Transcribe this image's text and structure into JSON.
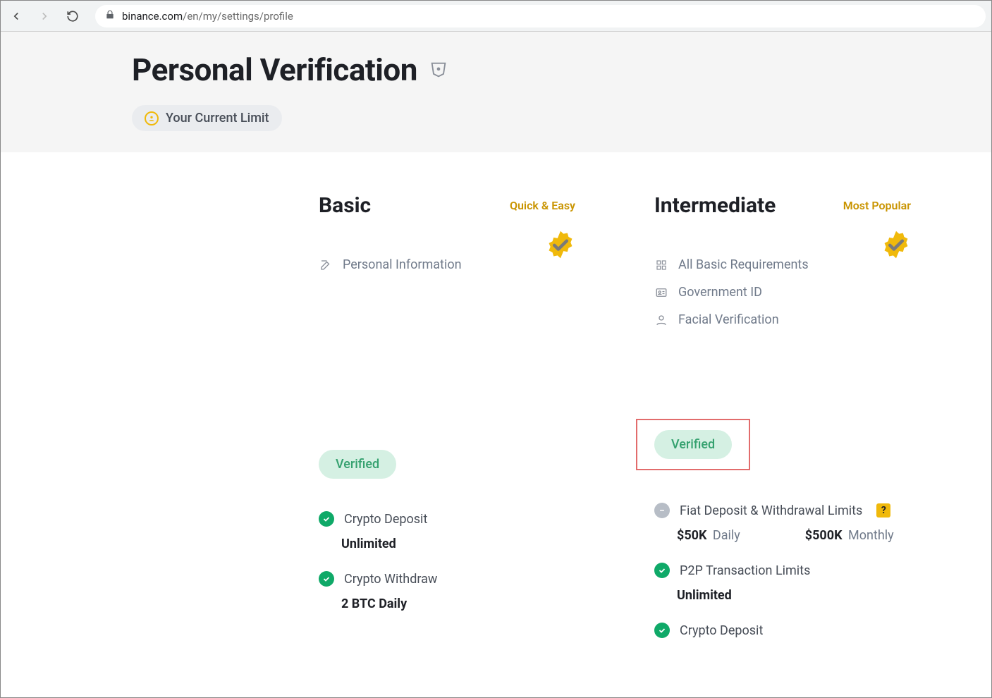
{
  "browser": {
    "url_domain": "binance.com",
    "url_path": "/en/my/settings/profile"
  },
  "header": {
    "title": "Personal Verification",
    "chip_label": "Your Current Limit"
  },
  "cards": {
    "basic": {
      "title": "Basic",
      "tag": "Quick & Easy",
      "req1": "Personal Information",
      "verified_label": "Verified",
      "limit1_label": "Crypto Deposit",
      "limit1_value": "Unlimited",
      "limit2_label": "Crypto Withdraw",
      "limit2_value": "2 BTC Daily"
    },
    "intermediate": {
      "title": "Intermediate",
      "tag": "Most Popular",
      "req1": "All Basic Requirements",
      "req2": "Government ID",
      "req3": "Facial Verification",
      "verified_label": "Verified",
      "fiat_label": "Fiat Deposit & Withdrawal Limits",
      "fiat_daily_amount": "$50K",
      "fiat_daily_period": "Daily",
      "fiat_monthly_amount": "$500K",
      "fiat_monthly_period": "Monthly",
      "p2p_label": "P2P Transaction Limits",
      "p2p_value": "Unlimited",
      "deposit_label": "Crypto Deposit",
      "help_char": "?"
    }
  }
}
